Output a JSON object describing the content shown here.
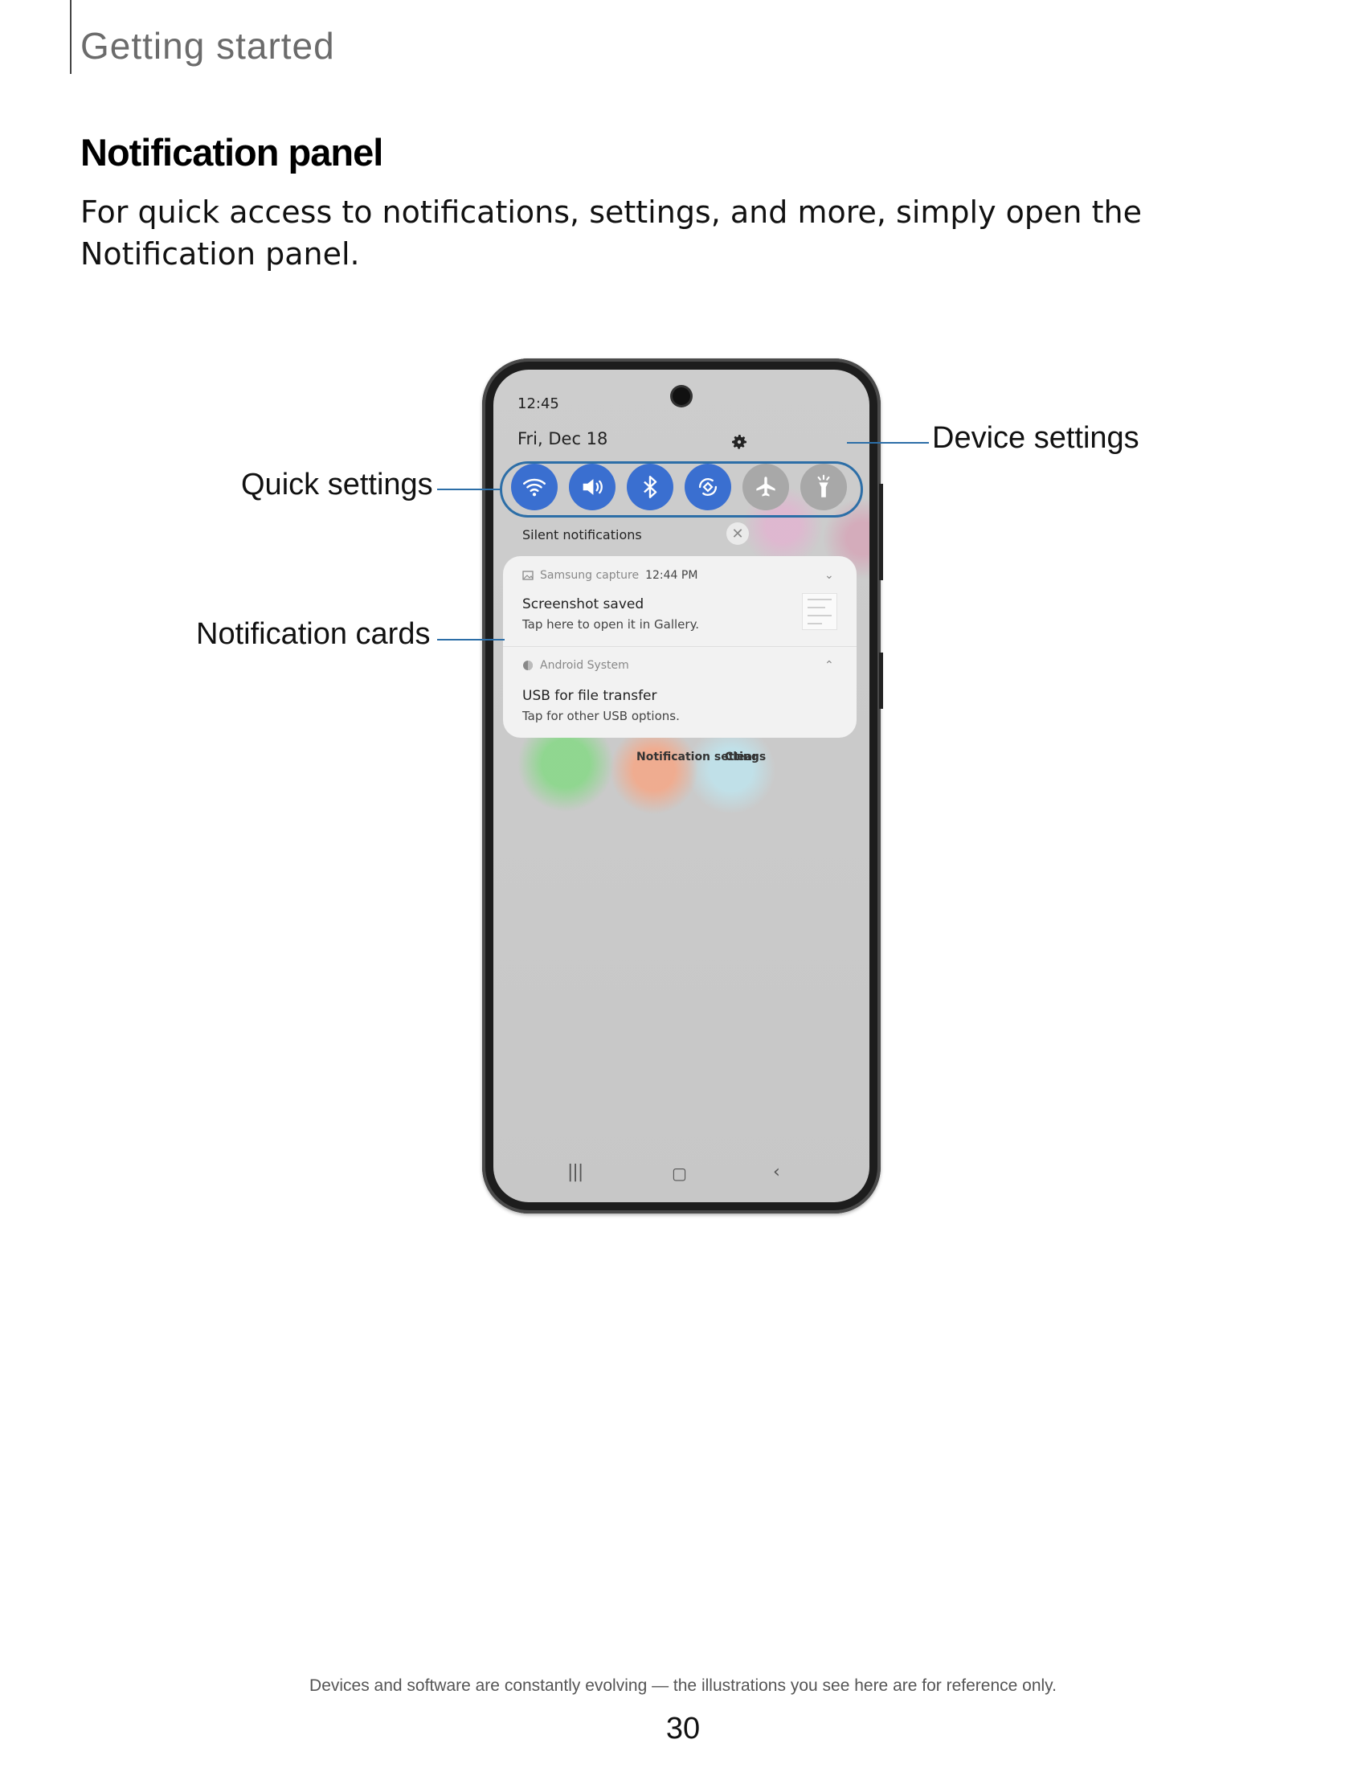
{
  "header": {
    "section": "Getting started"
  },
  "heading": "Notification panel",
  "intro": "For quick access to notifications, settings, and more, simply open the Notification panel.",
  "phone": {
    "status_time": "12:45",
    "date": "Fri, Dec 18",
    "quick_settings": [
      {
        "icon": "wifi-icon",
        "state": "on"
      },
      {
        "icon": "sound-icon",
        "state": "on"
      },
      {
        "icon": "bluetooth-icon",
        "state": "on"
      },
      {
        "icon": "auto-rotate-icon",
        "state": "on"
      },
      {
        "icon": "airplane-mode-icon",
        "state": "off"
      },
      {
        "icon": "flashlight-icon",
        "state": "off"
      }
    ],
    "silent_label": "Silent notifications",
    "cards": [
      {
        "app": "Samsung capture",
        "time": "12:44 PM",
        "title": "Screenshot saved",
        "subtitle": "Tap here to open it in Gallery."
      },
      {
        "app": "Android System",
        "time": "",
        "title": "USB for file transfer",
        "subtitle": "Tap for other USB options."
      }
    ],
    "notification_settings": "Notification settings",
    "clear": "Clear"
  },
  "callouts": {
    "device_settings": "Device settings",
    "quick_settings": "Quick settings",
    "notification_cards": "Notification cards"
  },
  "colors": {
    "accent": "#2c6ea7",
    "toggle_on": "#3a6fd0",
    "toggle_off": "#a8a8a8"
  },
  "footer": {
    "note": "Devices and software are constantly evolving — the illustrations you see here are for reference only.",
    "page": "30"
  }
}
